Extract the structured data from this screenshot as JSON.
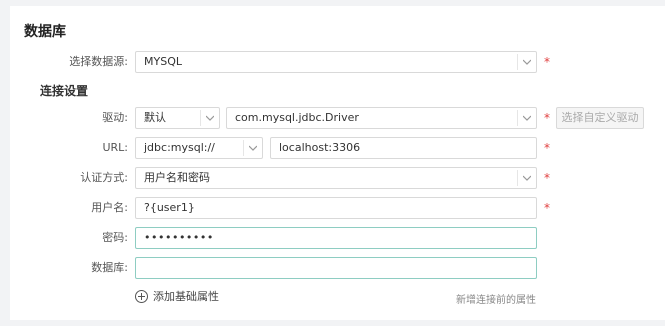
{
  "section_title": "数据库",
  "datasource": {
    "label": "选择数据源:",
    "value": "MYSQL",
    "required": "*"
  },
  "connection": {
    "title": "连接设置",
    "driver": {
      "label": "驱动:",
      "mode": "默认",
      "class": "com.mysql.jdbc.Driver",
      "required": "*",
      "custom_button": "选择自定义驱动"
    },
    "url": {
      "label": "URL:",
      "prefix": "jdbc:mysql://",
      "host": "localhost:3306",
      "required": "*"
    },
    "auth": {
      "label": "认证方式:",
      "value": "用户名和密码",
      "required": "*"
    },
    "username": {
      "label": "用户名:",
      "value": "?{user1}",
      "required": "*"
    },
    "password": {
      "label": "密码:",
      "value": "••••••••••"
    },
    "database": {
      "label": "数据库:",
      "value": ""
    }
  },
  "add_property": {
    "icon": "plus-circle-icon",
    "label": "添加基础属性"
  },
  "hint": "新增连接前的属性",
  "colors": {
    "required": "#e03e3e",
    "focus_border": "#8ecdc2"
  }
}
